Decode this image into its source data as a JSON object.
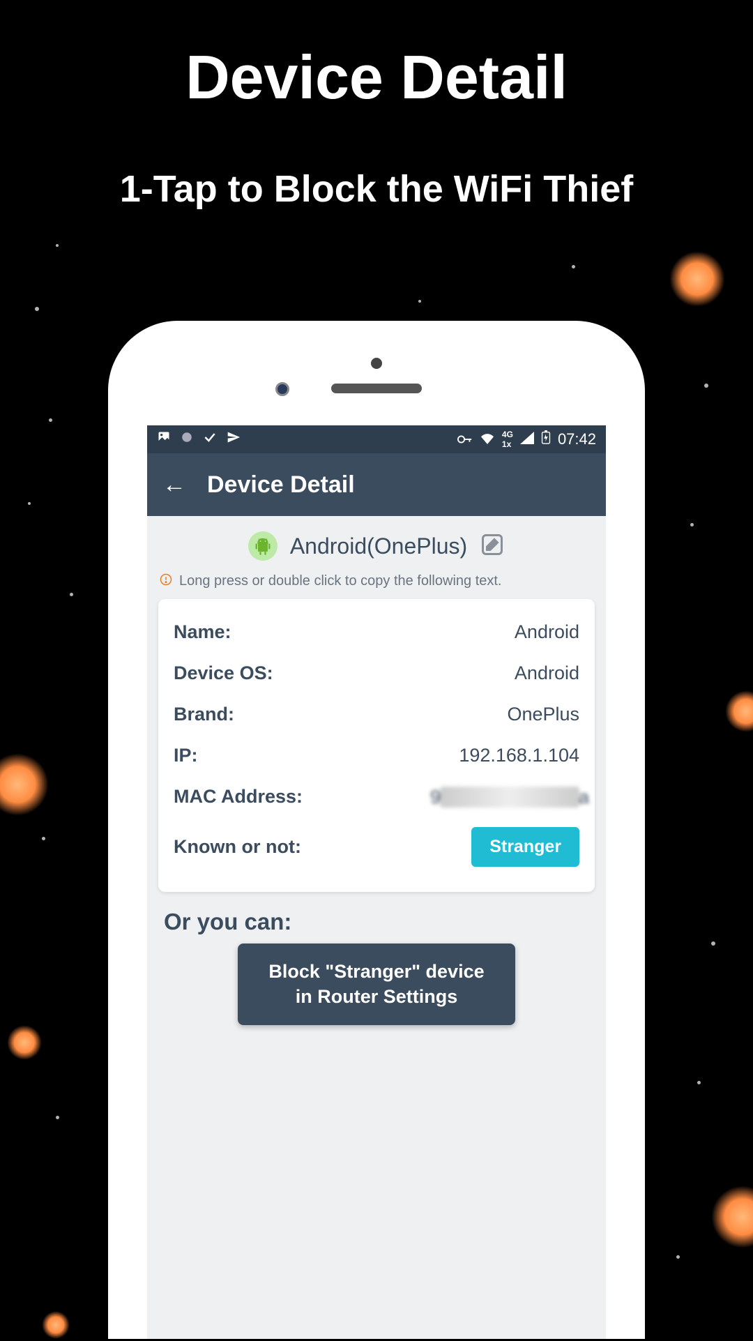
{
  "promo": {
    "title": "Device Detail",
    "subtitle": "1-Tap to Block the WiFi Thief"
  },
  "statusBar": {
    "time": "07:42"
  },
  "appBar": {
    "title": "Device Detail"
  },
  "device": {
    "headerName": "Android(OnePlus)",
    "hint": "Long press or double click to copy the following text."
  },
  "details": {
    "nameLabel": "Name:",
    "nameValue": "Android",
    "osLabel": "Device OS:",
    "osValue": "Android",
    "brandLabel": "Brand:",
    "brandValue": "OnePlus",
    "ipLabel": "IP:",
    "ipValue": "192.168.1.104",
    "macLabel": "MAC Address:",
    "knownLabel": "Known or not:",
    "strangerBtn": "Stranger"
  },
  "action": {
    "orTitle": "Or you can:",
    "blockLine1": "Block \"Stranger\" device",
    "blockLine2": "in Router Settings"
  }
}
